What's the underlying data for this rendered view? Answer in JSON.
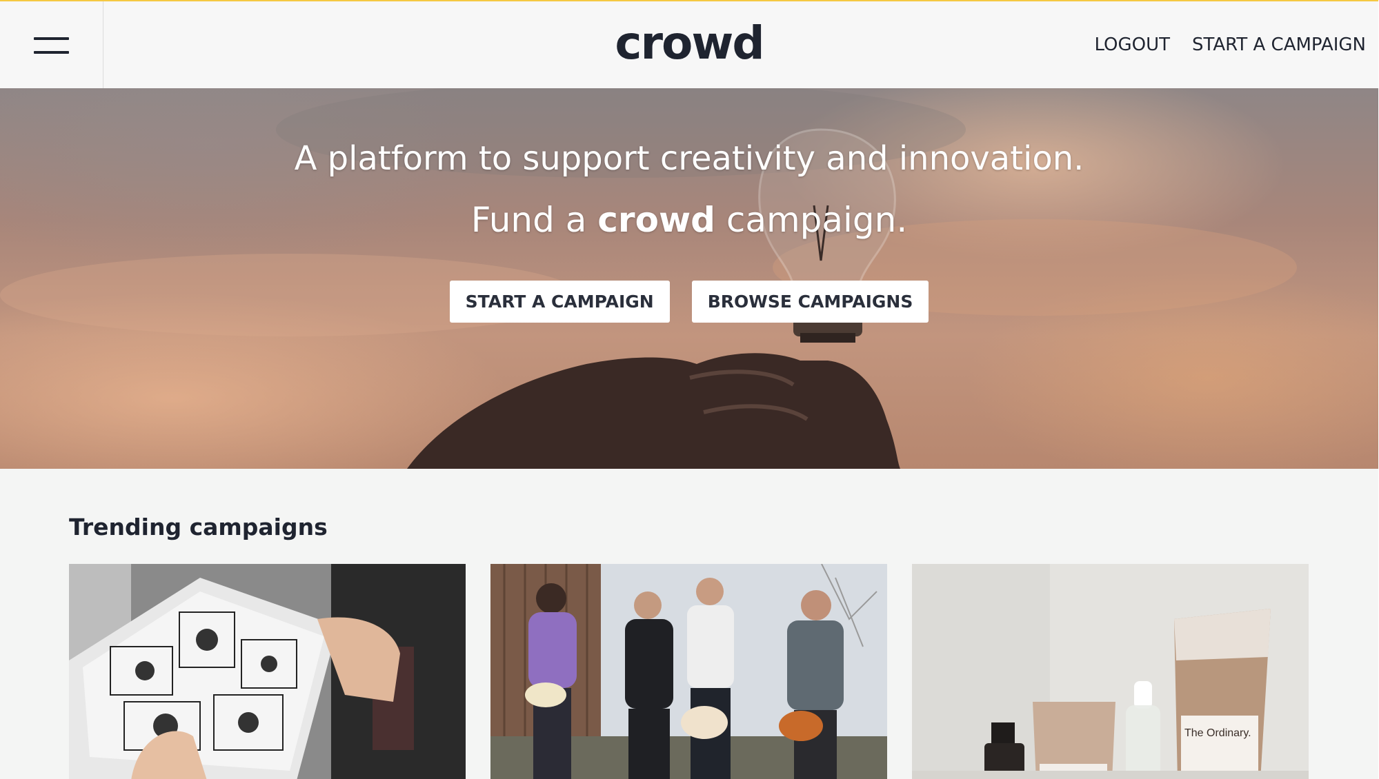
{
  "header": {
    "logo": "crowd",
    "nav": {
      "logout": "LOGOUT",
      "start_campaign": "START A CAMPAIGN"
    },
    "menu_icon": "hamburger-menu-icon",
    "accent_color": "#f5c842"
  },
  "hero": {
    "tagline": "A platform to support creativity and innovation.",
    "sub_prefix": "Fund a ",
    "sub_brand": "crowd",
    "sub_suffix": " campaign.",
    "buttons": {
      "start": "START A CAMPAIGN",
      "browse": "BROWSE CAMPAIGNS"
    }
  },
  "trending": {
    "title": "Trending campaigns",
    "campaigns": [
      {
        "image_subject": "comic-book"
      },
      {
        "image_subject": "band-photo"
      },
      {
        "image_subject": "skincare-products",
        "visible_text": "The Ordinary."
      }
    ]
  },
  "colors": {
    "text_dark": "#1f2430",
    "page_bg": "#f4f5f4",
    "button_bg": "#ffffff"
  }
}
